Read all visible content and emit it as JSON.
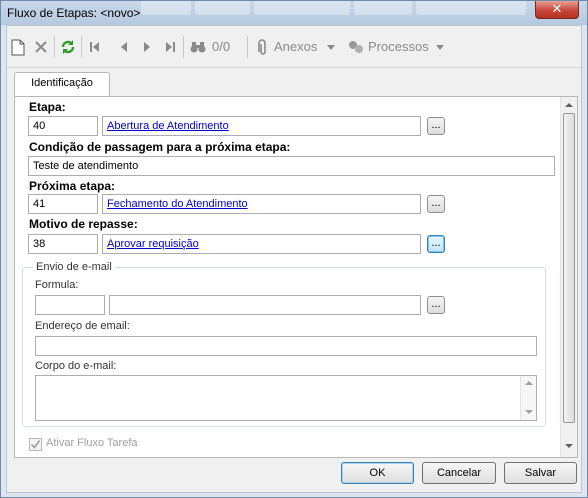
{
  "window": {
    "title": "Fluxo de Etapas: <novo>",
    "close_label": "✕"
  },
  "toolbar": {
    "record_position": "0/0",
    "attachments_label": "Anexos",
    "processes_label": "Processos"
  },
  "tabs": [
    {
      "label": "Identificação",
      "active": true
    }
  ],
  "form": {
    "etapa": {
      "label": "Etapa:",
      "code": "40",
      "name": "Abertura de Atendimento",
      "button": "..."
    },
    "condicao": {
      "label": "Condição de passagem para a próxima etapa:",
      "value": "Teste de atendimento"
    },
    "proxima": {
      "label": "Próxima etapa:",
      "code": "41",
      "name": "Fechamento do Atendimento",
      "button": "..."
    },
    "motivo": {
      "label": "Motivo de repasse:",
      "code": "38",
      "name": "Aprovar requisição",
      "button": "..."
    }
  },
  "email": {
    "group_title": "Envio de e-mail",
    "formula_label": "Formula:",
    "formula_code": "",
    "formula_name": "",
    "formula_button": "...",
    "address_label": "Endereço de email:",
    "address_value": "",
    "body_label": "Corpo do e-mail:",
    "body_value": ""
  },
  "ativar_fluxo": {
    "label": "Ativar Fluxo Tarefa",
    "checked": true,
    "enabled": false
  },
  "buttons": {
    "ok": "OK",
    "cancel": "Cancelar",
    "save": "Salvar"
  },
  "colors": {
    "link": "#0000cc",
    "title_close": "#c8473a",
    "toolbar_green": "#2e9a2e"
  }
}
